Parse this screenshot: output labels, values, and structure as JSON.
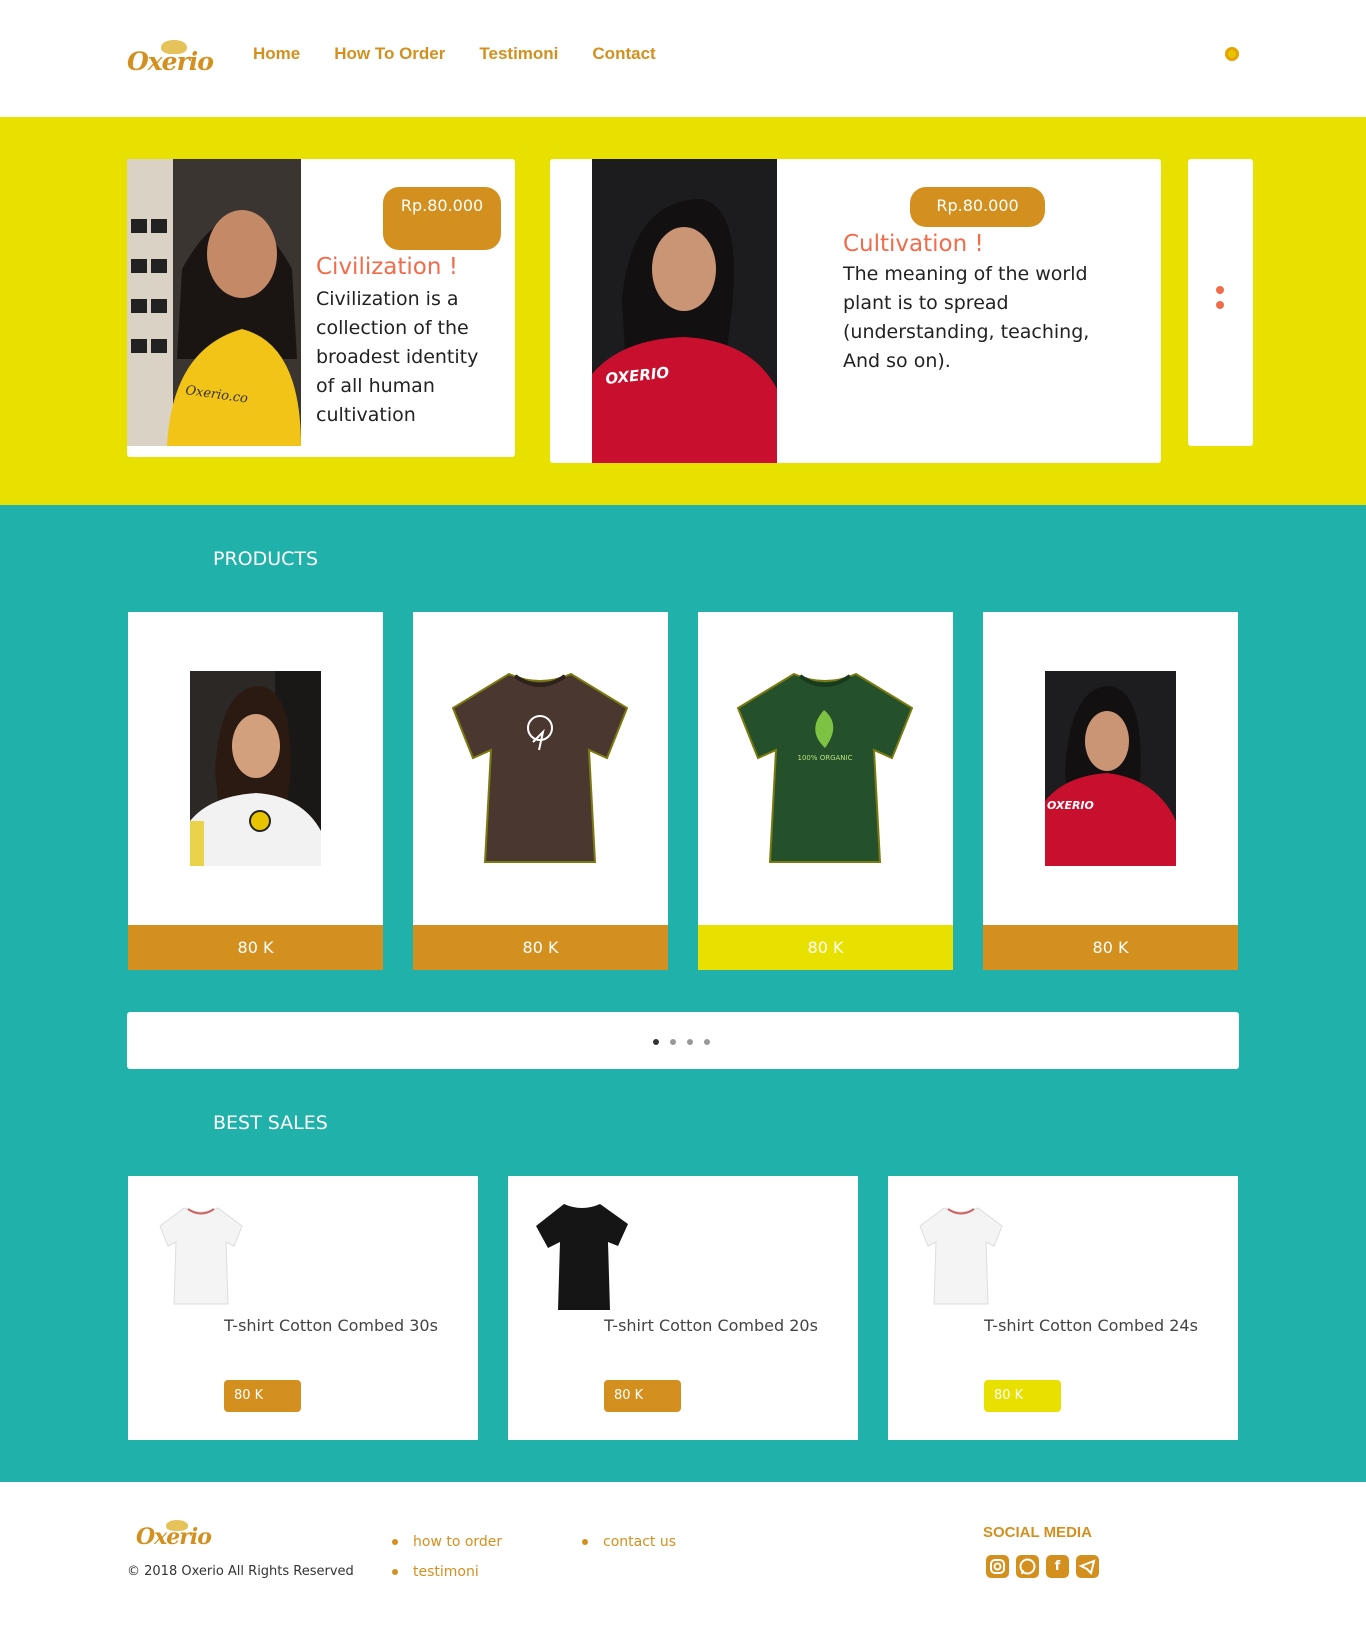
{
  "brand": {
    "name": "Oxerio"
  },
  "nav": {
    "items": [
      "Home",
      "How To Order",
      "Testimoni",
      "Contact"
    ]
  },
  "hero": {
    "slides": [
      {
        "price": "Rp.80.000",
        "title": "Civilization !",
        "lines": [
          "Civilization is a",
          "collection of the",
          "broadest identity",
          "of all human",
          "cultivation"
        ],
        "shirt_text": "Oxerio.co"
      },
      {
        "price": "Rp.80.000",
        "title": "Cultivation !",
        "lines": [
          "The meaning of the world",
          "plant is to spread",
          "(understanding, teaching,",
          "And so on)."
        ],
        "shirt_text": "OXERIO"
      }
    ]
  },
  "products": {
    "title": "PRODUCTS",
    "items": [
      {
        "price": "80 K",
        "color": "#d4901f",
        "icon": "photo-girl-white-shirt"
      },
      {
        "price": "80 K",
        "color": "#d4901f",
        "icon": "brown-tshirt"
      },
      {
        "price": "80 K",
        "color": "#e8e100",
        "icon": "green-tshirt-leaf",
        "print_text": "100% ORGANIC"
      },
      {
        "price": "80 K",
        "color": "#d4901f",
        "icon": "photo-girl-red-shirt",
        "shirt_text": "OXERIO"
      }
    ],
    "pager_dots": 4,
    "pager_active": 0
  },
  "best_sales": {
    "title": "BEST SALES",
    "items": [
      {
        "name": "T-shirt Cotton Combed 30s",
        "price": "80 K",
        "color": "#d4901f",
        "shirt": "white"
      },
      {
        "name": "T-shirt Cotton Combed 20s",
        "price": "80 K",
        "color": "#d4901f",
        "shirt": "black"
      },
      {
        "name": "T-shirt Cotton Combed 24s",
        "price": "80 K",
        "color": "#e8e100",
        "shirt": "white"
      }
    ]
  },
  "footer": {
    "copyright": "© 2018 Oxerio All Rights Reserved",
    "links": [
      "how to order",
      "testimoni",
      "contact us"
    ],
    "social_title": "SOCIAL MEDIA",
    "social": [
      "instagram-icon",
      "whatsapp-icon",
      "facebook-icon",
      "telegram-icon"
    ]
  },
  "colors": {
    "accent": "#d4901f",
    "yellow": "#e8e100",
    "teal": "#20b2aa",
    "coral": "#f26b4a"
  }
}
